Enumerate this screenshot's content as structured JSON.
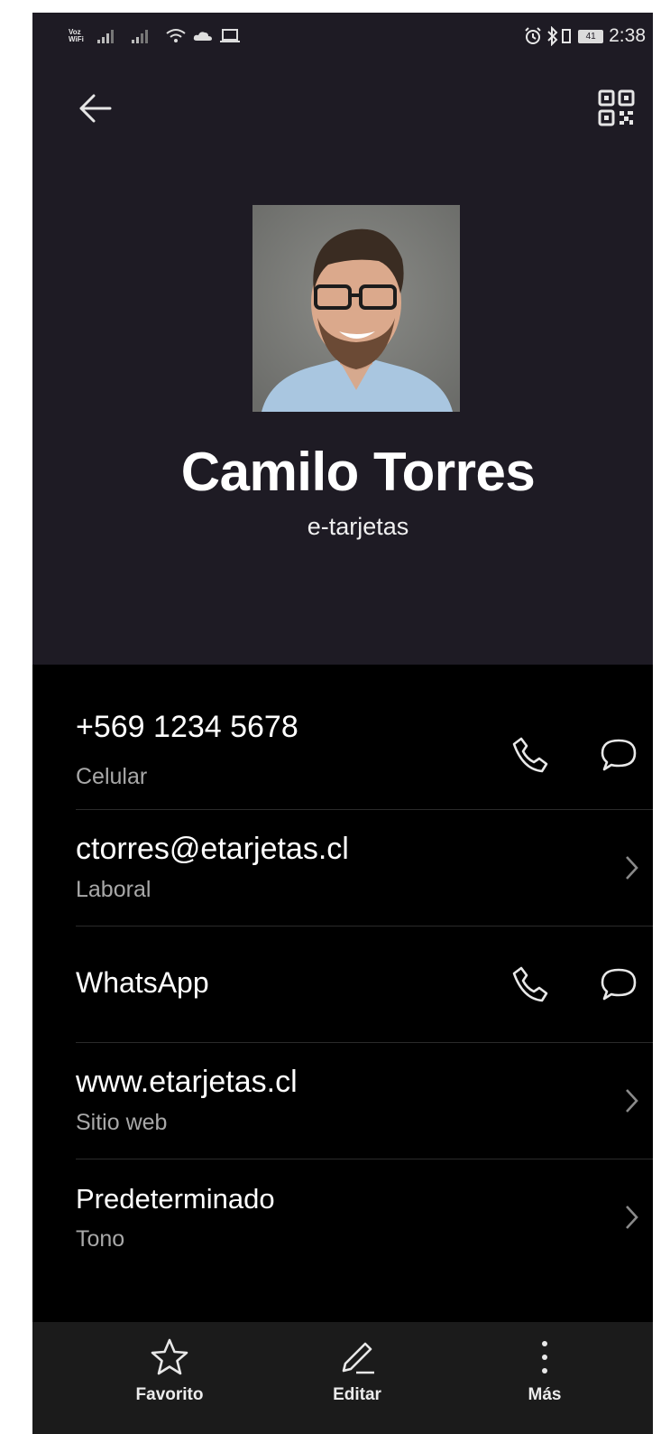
{
  "status_bar": {
    "voz_wifi": "Voz WiFi",
    "battery": "41",
    "time": "2:38"
  },
  "header": {
    "back_icon": "arrow-left-icon",
    "qr_icon": "qr-code-icon"
  },
  "contact": {
    "name": "Camilo Torres",
    "company": "e-tarjetas"
  },
  "details": [
    {
      "value": "+569 1234 5678",
      "type": "Celular",
      "actions": [
        "phone-icon",
        "message-icon"
      ]
    },
    {
      "value": "ctorres@etarjetas.cl",
      "type": "Laboral",
      "actions": [
        "chevron-right-icon"
      ]
    },
    {
      "value": "WhatsApp",
      "type": "",
      "actions": [
        "phone-icon",
        "message-icon"
      ]
    },
    {
      "value": "www.etarjetas.cl",
      "type": "Sitio web",
      "actions": [
        "chevron-right-icon"
      ]
    },
    {
      "value": "Predeterminado",
      "type": "Tono",
      "actions": [
        "chevron-right-icon"
      ]
    }
  ],
  "bottom_nav": [
    {
      "label": "Favorito",
      "icon": "star-icon"
    },
    {
      "label": "Editar",
      "icon": "pencil-icon"
    },
    {
      "label": "Más",
      "icon": "more-vertical-icon"
    }
  ],
  "colors": {
    "header_bg": "#1e1b24",
    "list_bg": "#000000",
    "bottom_bar_bg": "#1b1b1b",
    "primary_text": "#ffffff",
    "secondary_text": "#a8a8a8"
  }
}
